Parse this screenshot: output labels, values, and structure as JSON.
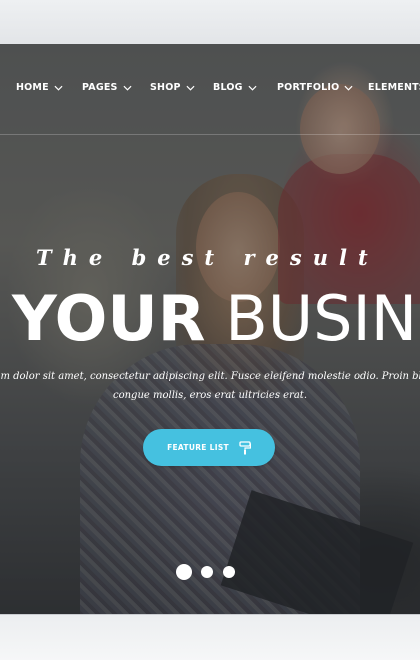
{
  "nav": {
    "items": [
      {
        "label": "HOME"
      },
      {
        "label": "PAGES"
      },
      {
        "label": "SHOP"
      },
      {
        "label": "BLOG"
      },
      {
        "label": "PORTFOLIO"
      },
      {
        "label": "ELEMENTS"
      }
    ]
  },
  "hero": {
    "tagline": "The best result",
    "headline_strong": "YOUR",
    "headline_light": "BUSIN",
    "description_line1": "um dolor sit amet, consectetur adipiscing elit. Fusce eleifend molestie odio. Proin blanc",
    "description_line2": "congue mollis, eros erat ultricies erat.",
    "cta_label": "FEATURE LIST",
    "cta_icon": "paint-roller-icon"
  },
  "slider": {
    "slide_count": 3,
    "active_index": 0
  },
  "colors": {
    "accent": "#45c1e0",
    "text": "#ffffff",
    "overlay": "#23262a"
  }
}
